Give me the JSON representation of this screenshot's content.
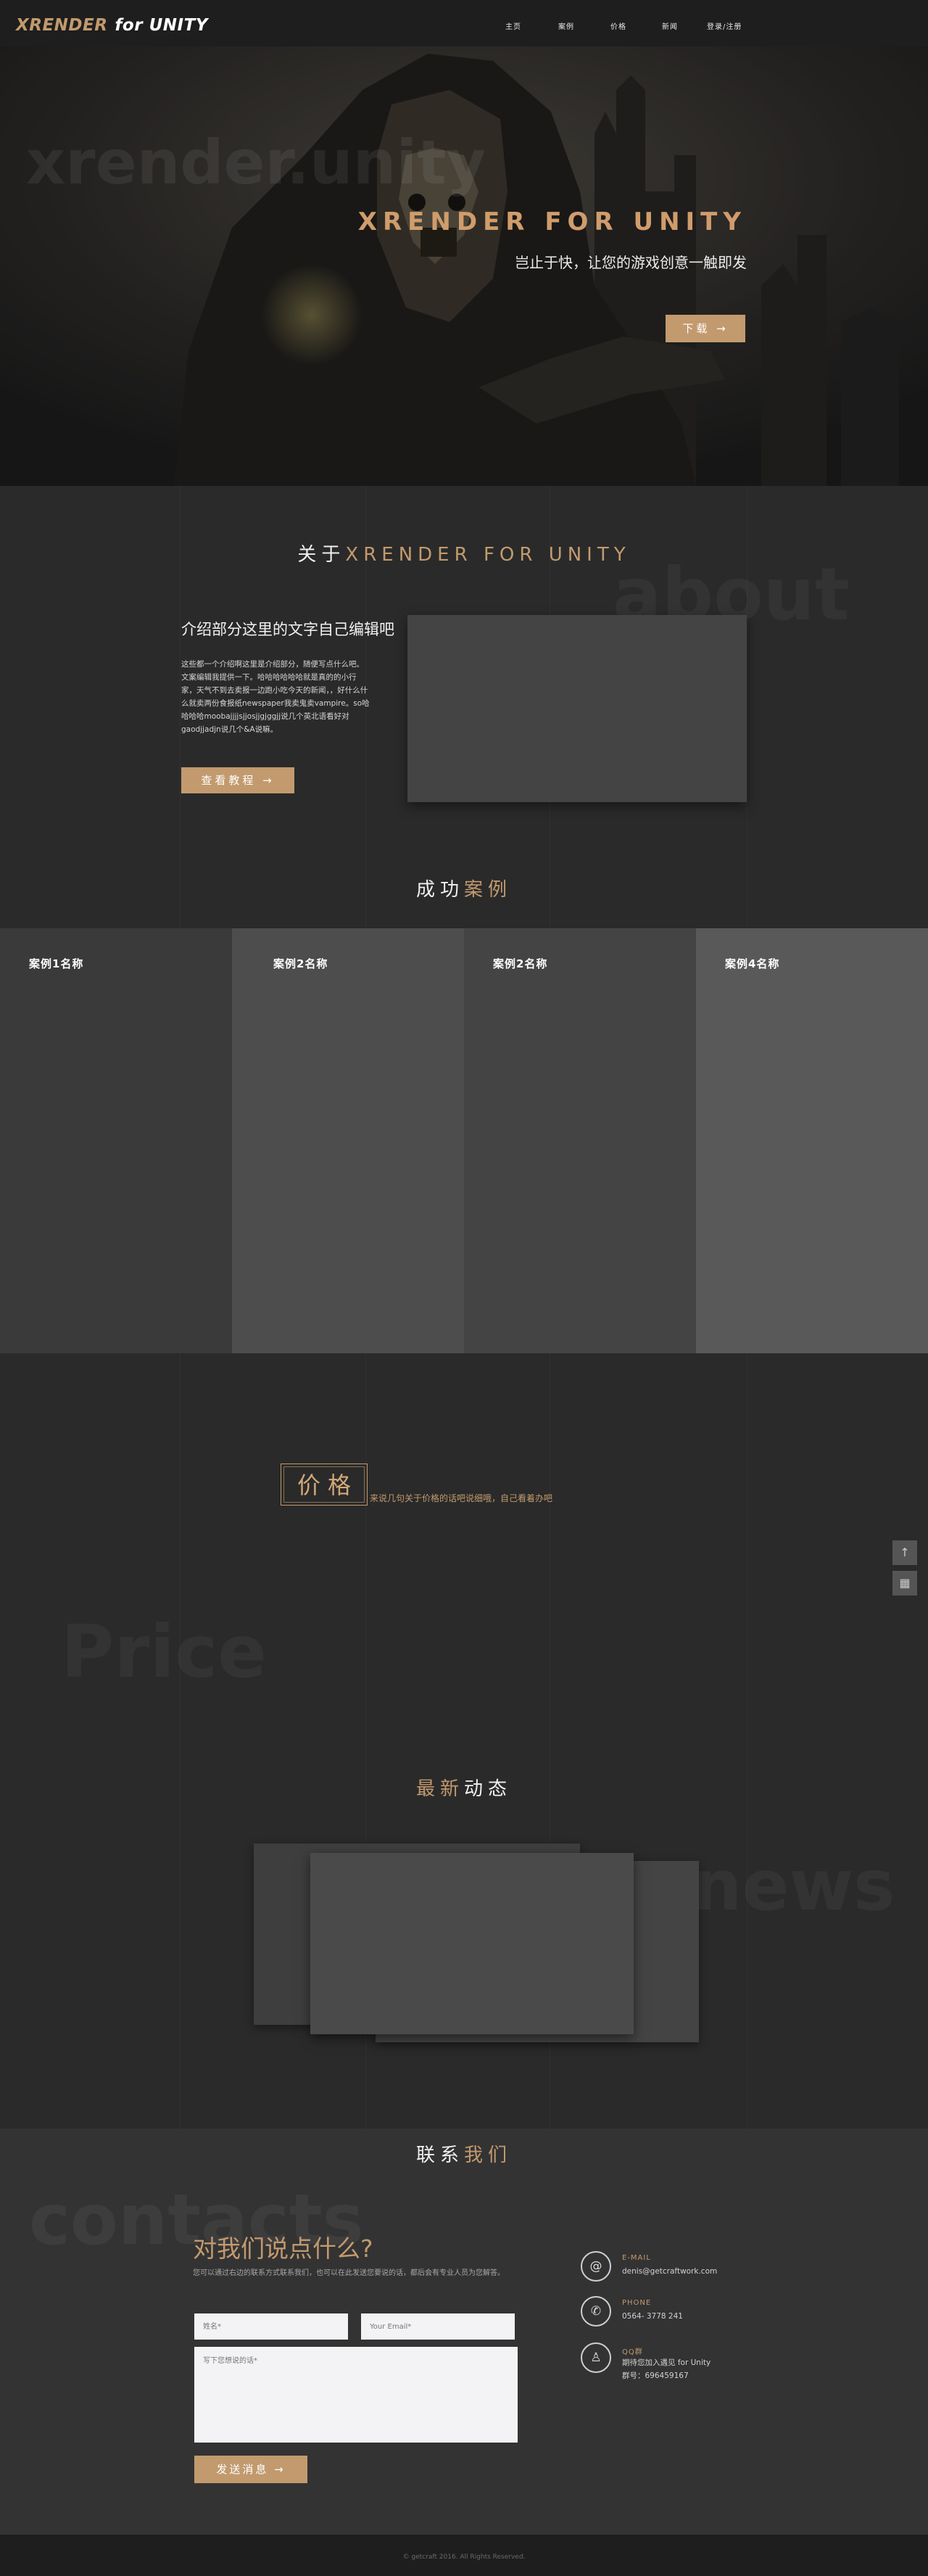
{
  "header": {
    "logo_primary": "XRENDER",
    "logo_secondary": "for UNITY",
    "nav": [
      "主页",
      "案例",
      "价格",
      "新闻",
      "登录/注册"
    ]
  },
  "hero": {
    "ghost_text": "xrender.unity",
    "title": "XRENDER FOR UNITY",
    "subtitle": "岂止于快，让您的游戏创意一触即发",
    "download_label": "下载 →"
  },
  "about": {
    "title_prefix": "关于",
    "title_highlight": "XRENDER FOR UNITY",
    "ghost_text": "about",
    "heading": "介绍部分这里的文字自己编辑吧",
    "body": "这些都一个介绍啊这里是介绍部分，随便写点什么吧。文案编辑我提供一下。哈哈哈哈哈哈就是真的的小行家，天气不到去卖报一边跑小吃今天的新闻，，好什么什么就卖两份食报纸newspaper我卖鬼卖vampire。so哈哈哈哈moobajjjjsjjosjjgjggjj说几个英北语看好对gaodjjadjn说几个&A说嘛。",
    "button_label": "查看教程 →"
  },
  "cases": {
    "title_prefix": "成功",
    "title_highlight": "案例",
    "items": [
      {
        "name": "案例1名称",
        "color": "#3a3a3a"
      },
      {
        "name": "案例2名称",
        "color": "#4d4d4d"
      },
      {
        "name": "案例2名称",
        "color": "#444444"
      },
      {
        "name": "案例4名称",
        "color": "#595959"
      }
    ]
  },
  "price": {
    "title": "价格",
    "note": "来说几句关于价格的话吧说细哦，自己看着办吧",
    "ghost_text": "Price"
  },
  "side_buttons": {
    "top_icon": "↑",
    "qr_icon": "▦"
  },
  "news": {
    "title_highlight": "最新",
    "title_suffix": "动态",
    "ghost_text": "news"
  },
  "contacts": {
    "title_prefix": "联系",
    "title_highlight": "我们",
    "ghost_text": "contacts",
    "heading": "对我们说点什么?",
    "description": "您可以通过右边的联系方式联系我们，也可以在此发送您要说的话，都后会有专业人员为您解答。",
    "name_placeholder": "姓名*",
    "email_placeholder": "Your Email*",
    "message_placeholder": "写下您想说的话*",
    "send_label": "发送消息 →",
    "email_label": "E-MAIL",
    "email_value": "denis@getcraftwork.com",
    "phone_label": "PHONE",
    "phone_value": "0564- 3778 241",
    "qq_label": "QQ群",
    "qq_line1": "期待您加入遇见 for Unity",
    "qq_line2": "群号：696459167"
  },
  "footer": {
    "copyright": "© getcraft 2016. All Rights Reserved."
  },
  "colors": {
    "accent": "#c29a6e",
    "background": "#2a2a2a",
    "header": "#1e1e1e"
  }
}
